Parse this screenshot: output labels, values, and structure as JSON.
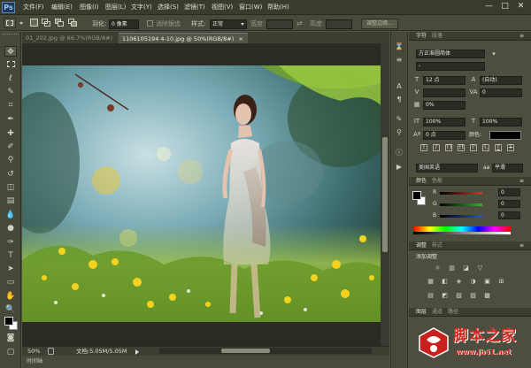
{
  "app": {
    "logo": "Ps",
    "window_controls": [
      "—",
      "□",
      "✕"
    ]
  },
  "menu": [
    "文件(F)",
    "编辑(E)",
    "图像(I)",
    "图层(L)",
    "文字(Y)",
    "选择(S)",
    "滤镜(T)",
    "视图(V)",
    "窗口(W)",
    "帮助(H)"
  ],
  "options": {
    "feather_label": "羽化:",
    "feather_value": "0 像素",
    "antialias_label": "消除锯齿",
    "style_label": "样式:",
    "style_value": "正常",
    "width_label": "宽度:",
    "height_label": "高度:",
    "refine_edge": "调整边缘..."
  },
  "tabs": [
    {
      "label": "01_202.jpg @ 66.7%(RGB/8#)",
      "close": "×"
    },
    {
      "label": "1106105194 4-10.jpg @ 50%(RGB/8#)",
      "close": "×"
    }
  ],
  "status": {
    "zoom": "50%",
    "doc": "文档:5.05M/5.05M"
  },
  "timeline_label": "时间轴",
  "character_panel": {
    "tab_active": "字符",
    "tab_inactive": "段落",
    "font_family": "方正准圆简体",
    "font_style": "-",
    "font_size": "12 点",
    "leading": "(自动)",
    "kerning": "",
    "tracking": "0",
    "scale_pct": "0%",
    "vertical_scale": "100%",
    "horizontal_scale": "100%",
    "baseline": "0 点",
    "color_label": "颜色:",
    "language": "美国英语",
    "antialias": "平滑",
    "type_styles": [
      "T",
      "T",
      "TT",
      "Tt",
      "T'",
      "T,",
      "T",
      "T"
    ],
    "aa_label": "aa"
  },
  "color_panel": {
    "tab_active": "颜色",
    "tab_inactive": "色板",
    "channels": [
      {
        "label": "R",
        "value": "0",
        "color": "#d83030"
      },
      {
        "label": "G",
        "value": "0",
        "color": "#30b030"
      },
      {
        "label": "B",
        "value": "0",
        "color": "#3050d8"
      }
    ]
  },
  "adjustments_panel": {
    "tab_active": "调整",
    "tab_inactive": "样式",
    "title": "添加调整",
    "row1": [
      "☼",
      "▥",
      "◪",
      "▽"
    ],
    "row2": [
      "▦",
      "◧",
      "◈",
      "◑",
      "▣",
      "⊞"
    ],
    "row3": [
      "▤",
      "◩",
      "▧",
      "▨",
      "▩"
    ]
  },
  "layers_panel": {
    "tab_active": "图层",
    "tabs_inactive": [
      "通道",
      "路径"
    ]
  },
  "watermark": {
    "name": "脚本之家",
    "url": "www.jb51.net"
  }
}
